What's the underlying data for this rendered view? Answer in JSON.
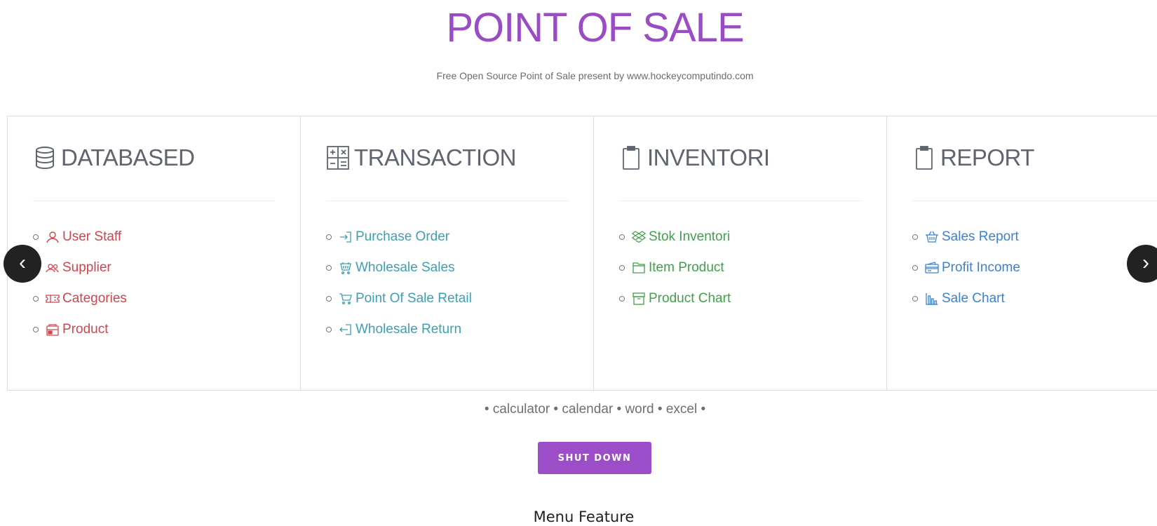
{
  "header": {
    "title": "POINT OF SALE",
    "subtitle": "Free Open Source Point of Sale present by www.hockeycomputindo.com"
  },
  "panels": [
    {
      "title": "DATABASED",
      "icon": "database-icon",
      "color": "#d0454c",
      "items": [
        {
          "label": "User Staff",
          "icon": "user-icon"
        },
        {
          "label": "Supplier",
          "icon": "users-icon"
        },
        {
          "label": "Categories",
          "icon": "ticket-icon"
        },
        {
          "label": "Product",
          "icon": "box-icon"
        }
      ]
    },
    {
      "title": "TRANSACTION",
      "icon": "calculator-icon",
      "color": "#3e9fb3",
      "items": [
        {
          "label": "Purchase Order",
          "icon": "sign-in-icon"
        },
        {
          "label": "Wholesale Sales",
          "icon": "shopping-basket-icon"
        },
        {
          "label": "Point Of Sale Retail",
          "icon": "cart-icon"
        },
        {
          "label": "Wholesale Return",
          "icon": "sign-out-icon"
        }
      ]
    },
    {
      "title": "INVENTORI",
      "icon": "clipboard-icon",
      "color": "#3fa24a",
      "items": [
        {
          "label": "Stok Inventori",
          "icon": "dropbox-icon"
        },
        {
          "label": "Item Product",
          "icon": "folder-icon"
        },
        {
          "label": "Product Chart",
          "icon": "archive-icon"
        }
      ]
    },
    {
      "title": "REPORT",
      "icon": "clipboard-icon",
      "color": "#3d82cf",
      "items": [
        {
          "label": "Sales Report",
          "icon": "basket-icon"
        },
        {
          "label": "Profit Income",
          "icon": "credit-card-icon"
        },
        {
          "label": "Sale Chart",
          "icon": "bar-chart-icon"
        }
      ]
    }
  ],
  "nav": {
    "prev": "‹",
    "next": "›"
  },
  "apps": {
    "separator": "•",
    "items": [
      "calculator",
      "calendar",
      "word",
      "excel"
    ]
  },
  "shutdown_label": "SHUT DOWN",
  "footer": "Menu Feature"
}
